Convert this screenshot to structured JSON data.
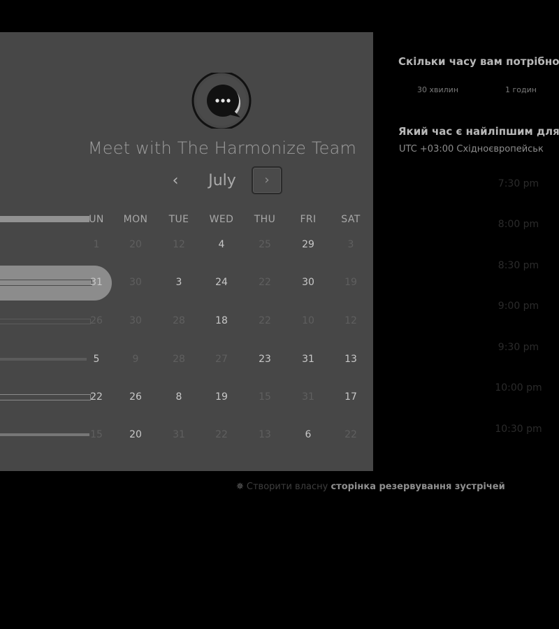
{
  "header": {
    "title": "Meet with The Harmonize Team"
  },
  "calendar": {
    "month": "July",
    "prev_icon": "‹",
    "next_icon": "›",
    "weekdays": [
      "UN",
      "MON",
      "TUE",
      "WED",
      "THU",
      "FRI",
      "SAT"
    ],
    "rows": [
      [
        {
          "t": "1",
          "s": "dim"
        },
        {
          "t": "20",
          "s": "dim"
        },
        {
          "t": "12",
          "s": "dim"
        },
        {
          "t": "4",
          "s": "bright"
        },
        {
          "t": "25",
          "s": "dim"
        },
        {
          "t": "29",
          "s": "bright"
        },
        {
          "t": "3",
          "s": "dim"
        }
      ],
      [
        {
          "t": "31",
          "s": "bright"
        },
        {
          "t": "30",
          "s": "dim"
        },
        {
          "t": "3",
          "s": "bright"
        },
        {
          "t": "24",
          "s": "bright"
        },
        {
          "t": "22",
          "s": "dim"
        },
        {
          "t": "30",
          "s": "bright"
        },
        {
          "t": "19",
          "s": "dim"
        }
      ],
      [
        {
          "t": "26",
          "s": "dim"
        },
        {
          "t": "30",
          "s": "dim"
        },
        {
          "t": "28",
          "s": "dim"
        },
        {
          "t": "18",
          "s": "bright"
        },
        {
          "t": "22",
          "s": "dim"
        },
        {
          "t": "10",
          "s": "dim"
        },
        {
          "t": "12",
          "s": "dim"
        }
      ],
      [
        {
          "t": "5",
          "s": "bright"
        },
        {
          "t": "9",
          "s": "dim"
        },
        {
          "t": "28",
          "s": "dim"
        },
        {
          "t": "27",
          "s": "dim"
        },
        {
          "t": "23",
          "s": "bright"
        },
        {
          "t": "31",
          "s": "bright"
        },
        {
          "t": "13",
          "s": "bright"
        }
      ],
      [
        {
          "t": "22",
          "s": "bright"
        },
        {
          "t": "26",
          "s": "bright"
        },
        {
          "t": "8",
          "s": "bright"
        },
        {
          "t": "19",
          "s": "bright"
        },
        {
          "t": "15",
          "s": "dim"
        },
        {
          "t": "31",
          "s": "dim"
        },
        {
          "t": "17",
          "s": "bright"
        }
      ],
      [
        {
          "t": "15",
          "s": "dim"
        },
        {
          "t": "20",
          "s": "bright"
        },
        {
          "t": "31",
          "s": "dim"
        },
        {
          "t": "22",
          "s": "dim"
        },
        {
          "t": "13",
          "s": "dim"
        },
        {
          "t": "6",
          "s": "bright"
        },
        {
          "t": "22",
          "s": "dim"
        }
      ]
    ]
  },
  "booking": {
    "duration_question": "Скільки часу вам потрібно",
    "durations": [
      "30 хвилин",
      "1 годин"
    ],
    "time_question": "Який час є найліпшим для",
    "timezone": "UTC +03:00 Східноєвропейськ",
    "slots": [
      "7:30 pm",
      "8:00 pm",
      "8:30 pm",
      "9:00 pm",
      "9:30 pm",
      "10:00 pm",
      "10:30 pm"
    ]
  },
  "footer": {
    "icon": "sprocket-icon",
    "prefix": "Створити власну",
    "link": "сторінка резервування зустрічей"
  }
}
